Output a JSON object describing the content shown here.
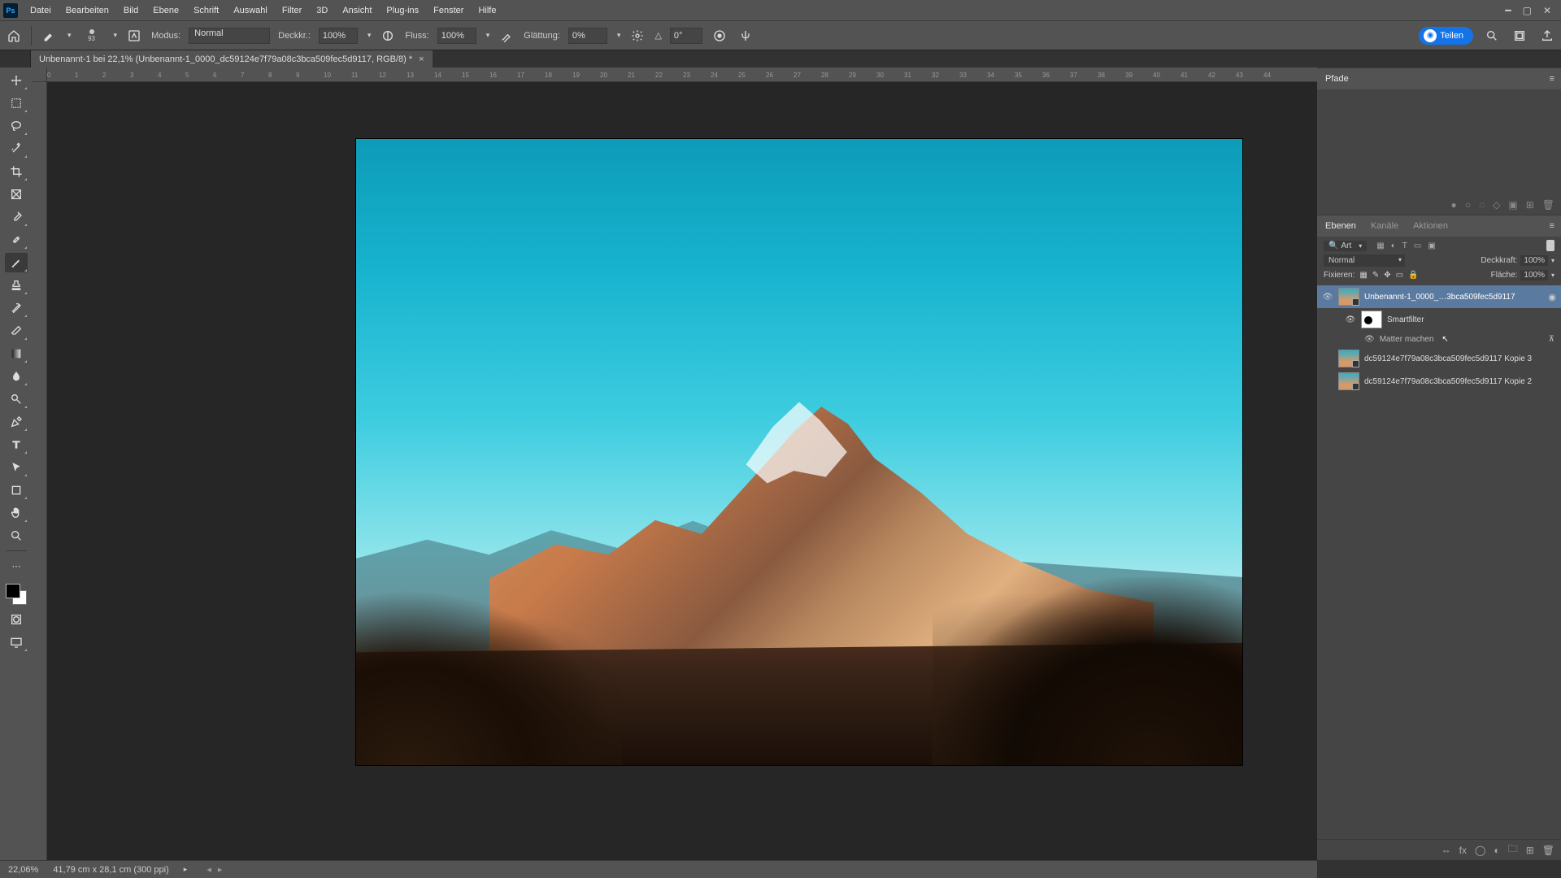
{
  "menu": {
    "items": [
      "Datei",
      "Bearbeiten",
      "Bild",
      "Ebene",
      "Schrift",
      "Auswahl",
      "Filter",
      "3D",
      "Ansicht",
      "Plug-ins",
      "Fenster",
      "Hilfe"
    ]
  },
  "options": {
    "brush_size": "93",
    "modus_label": "Modus:",
    "modus_value": "Normal",
    "deck_label": "Deckkr.:",
    "deck_value": "100%",
    "fluss_label": "Fluss:",
    "fluss_value": "100%",
    "glatt_label": "Glättung:",
    "glatt_value": "0%",
    "angle_icon": "△",
    "angle_value": "0°",
    "teilen": "Teilen"
  },
  "doc": {
    "tab_title": "Unbenannt-1 bei 22,1% (Unbenannt-1_0000_dc59124e7f79a08c3bca509fec5d9117, RGB/8) *"
  },
  "ruler": {
    "h": [
      "0",
      "1",
      "2",
      "3",
      "4",
      "5",
      "6",
      "7",
      "8",
      "9",
      "10",
      "11",
      "12",
      "13",
      "14",
      "15",
      "16",
      "17",
      "18",
      "19",
      "20",
      "21",
      "22",
      "23",
      "24",
      "25",
      "26",
      "27",
      "28",
      "29",
      "30",
      "31",
      "32",
      "33",
      "34",
      "35",
      "36",
      "37",
      "38",
      "39",
      "40",
      "41",
      "42",
      "43",
      "44"
    ]
  },
  "panels": {
    "paths_tab": "Pfade",
    "layers_tabs": [
      "Ebenen",
      "Kanäle",
      "Aktionen"
    ],
    "search_kind": "Art",
    "blend": "Normal",
    "opacity_label": "Deckkraft:",
    "opacity": "100%",
    "fix_label": "Fixieren:",
    "fill_label": "Fläche:",
    "fill": "100%"
  },
  "layers": {
    "l1": "Unbenannt-1_0000_…3bca509fec5d9117",
    "smart": "Smartfilter",
    "sfilter": "Matter machen",
    "l2": "dc59124e7f79a08c3bca509fec5d9117 Kopie 3",
    "l3": "dc59124e7f79a08c3bca509fec5d9117 Kopie 2"
  },
  "status": {
    "zoom": "22,06%",
    "dims": "41,79 cm x 28,1 cm (300 ppi)"
  }
}
